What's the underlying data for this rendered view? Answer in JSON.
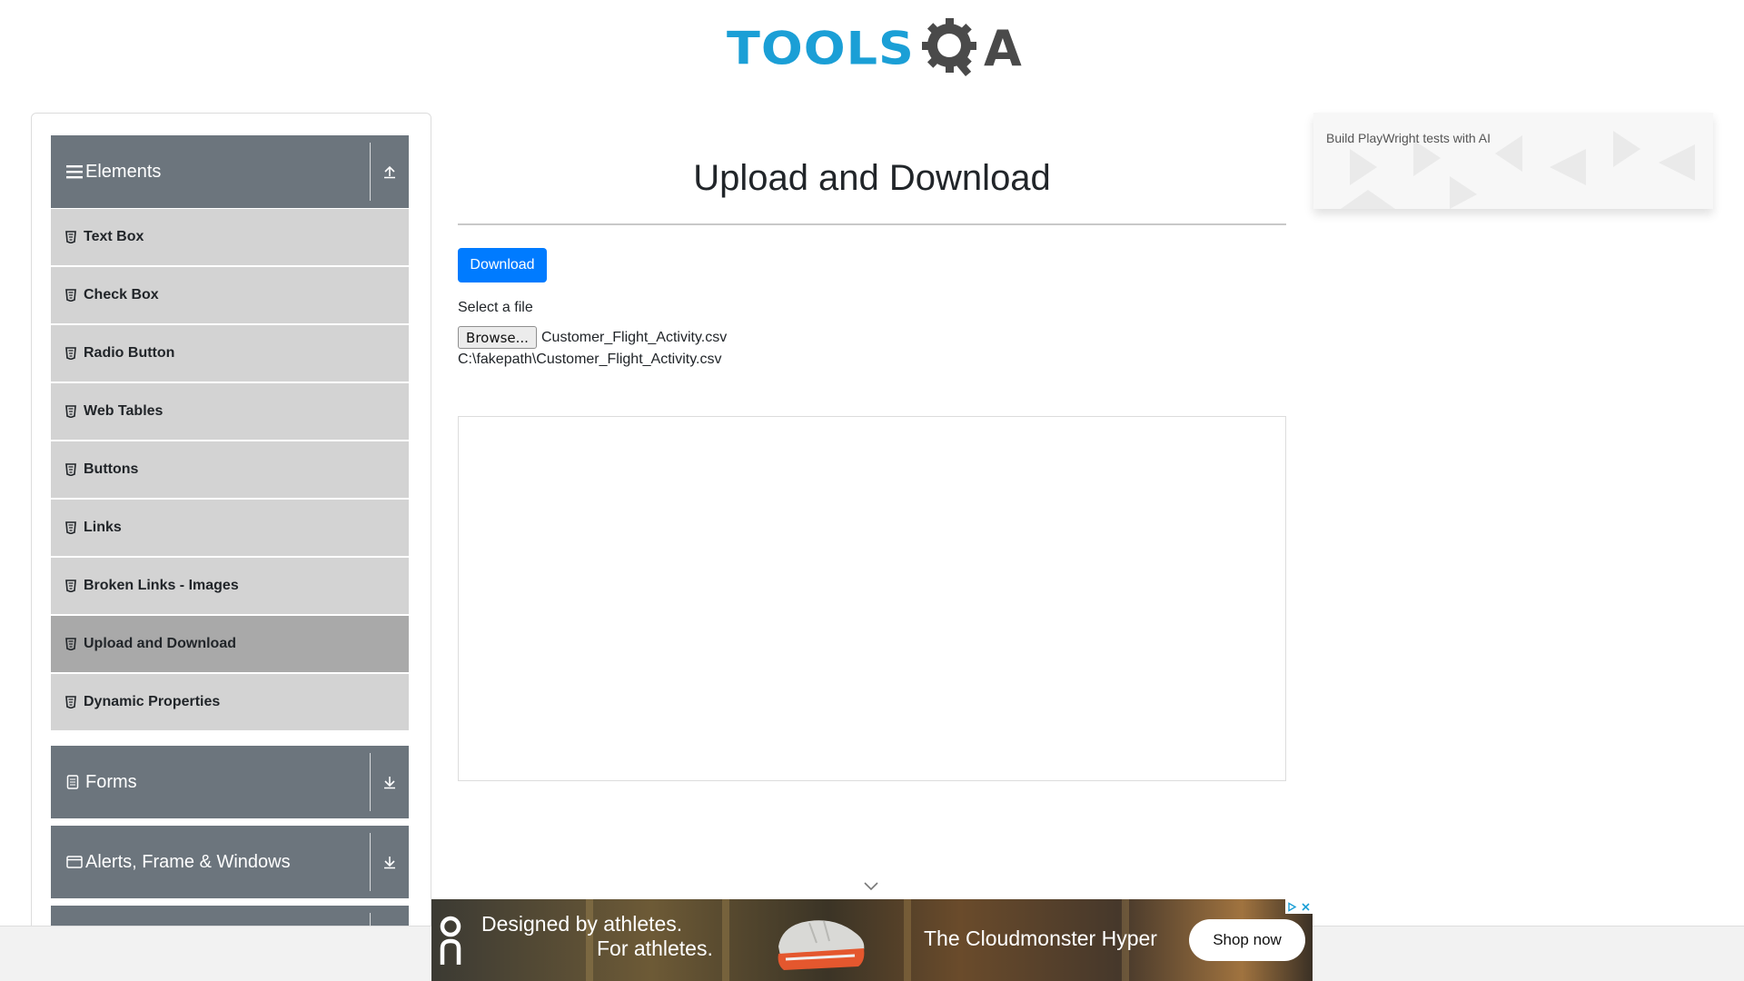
{
  "header": {
    "logo_text": "TOOLS",
    "logo_suffix": "A"
  },
  "sidebar": {
    "groups": [
      {
        "label": "Elements",
        "icon": "hamburger-icon",
        "toggle": "collapse-up-icon",
        "expanded": true
      },
      {
        "label": "Forms",
        "icon": "document-icon",
        "toggle": "expand-down-icon",
        "expanded": false
      },
      {
        "label": "Alerts, Frame & Windows",
        "icon": "window-icon",
        "toggle": "expand-down-icon",
        "expanded": false
      }
    ],
    "items": [
      {
        "label": "Text Box",
        "active": false
      },
      {
        "label": "Check Box",
        "active": false
      },
      {
        "label": "Radio Button",
        "active": false
      },
      {
        "label": "Web Tables",
        "active": false
      },
      {
        "label": "Buttons",
        "active": false
      },
      {
        "label": "Links",
        "active": false
      },
      {
        "label": "Broken Links - Images",
        "active": false
      },
      {
        "label": "Upload and Download",
        "active": true
      },
      {
        "label": "Dynamic Properties",
        "active": false
      }
    ]
  },
  "main": {
    "title": "Upload and Download",
    "download_label": "Download",
    "file_label": "Select a file",
    "browse_label": "Browse...",
    "file_name": "Customer_Flight_Activity.csv",
    "uploaded_path": "C:\\fakepath\\Customer_Flight_Activity.csv"
  },
  "side_ad": {
    "text": "Build PlayWright tests with AI"
  },
  "bottom_ad": {
    "headline_line1": "Designed by athletes.",
    "headline_line2": "For athletes.",
    "product": "The Cloudmonster Hyper",
    "cta": "Shop now"
  },
  "colors": {
    "brand_blue": "#1b9fd6",
    "group_header": "#6c757d",
    "menu_item": "#d3d3d3",
    "menu_item_active": "#a9a9a9",
    "primary_button": "#007bff"
  }
}
